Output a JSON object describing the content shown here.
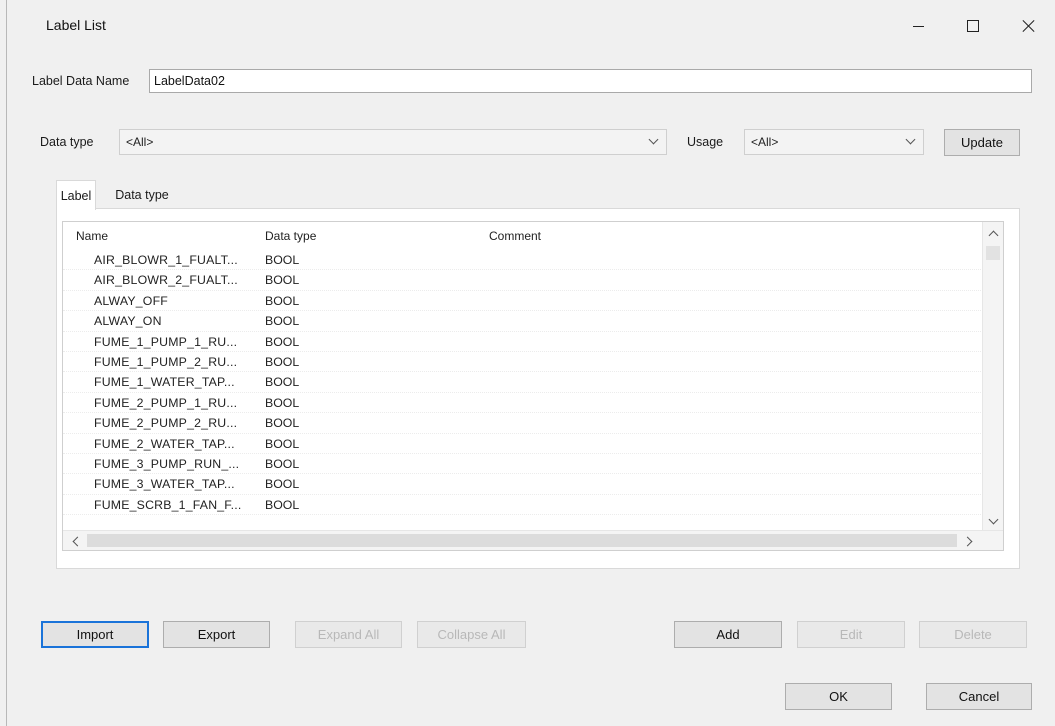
{
  "window": {
    "title": "Label List"
  },
  "form": {
    "label_data_name_label": "Label Data Name",
    "label_data_name_value": "LabelData02",
    "data_type_label": "Data type",
    "data_type_value": "<All>",
    "usage_label": "Usage",
    "usage_value": "<All>",
    "update_label": "Update"
  },
  "tabs": [
    {
      "label": "Label"
    },
    {
      "label": "Data type"
    }
  ],
  "grid": {
    "columns": [
      "Name",
      "Data type",
      "Comment"
    ],
    "rows": [
      {
        "name": "AIR_BLOWR_1_FUALT...",
        "type": "BOOL",
        "comment": ""
      },
      {
        "name": "AIR_BLOWR_2_FUALT...",
        "type": "BOOL",
        "comment": ""
      },
      {
        "name": "ALWAY_OFF",
        "type": "BOOL",
        "comment": ""
      },
      {
        "name": "ALWAY_ON",
        "type": "BOOL",
        "comment": ""
      },
      {
        "name": "FUME_1_PUMP_1_RU...",
        "type": "BOOL",
        "comment": ""
      },
      {
        "name": "FUME_1_PUMP_2_RU...",
        "type": "BOOL",
        "comment": ""
      },
      {
        "name": "FUME_1_WATER_TAP...",
        "type": "BOOL",
        "comment": ""
      },
      {
        "name": "FUME_2_PUMP_1_RU...",
        "type": "BOOL",
        "comment": ""
      },
      {
        "name": "FUME_2_PUMP_2_RU...",
        "type": "BOOL",
        "comment": ""
      },
      {
        "name": "FUME_2_WATER_TAP...",
        "type": "BOOL",
        "comment": ""
      },
      {
        "name": "FUME_3_PUMP_RUN_...",
        "type": "BOOL",
        "comment": ""
      },
      {
        "name": "FUME_3_WATER_TAP...",
        "type": "BOOL",
        "comment": ""
      },
      {
        "name": "FUME_SCRB_1_FAN_F...",
        "type": "BOOL",
        "comment": ""
      }
    ]
  },
  "buttons": {
    "import": "Import",
    "export": "Export",
    "expand_all": "Expand All",
    "collapse_all": "Collapse All",
    "add": "Add",
    "edit": "Edit",
    "delete": "Delete",
    "ok": "OK",
    "cancel": "Cancel"
  }
}
